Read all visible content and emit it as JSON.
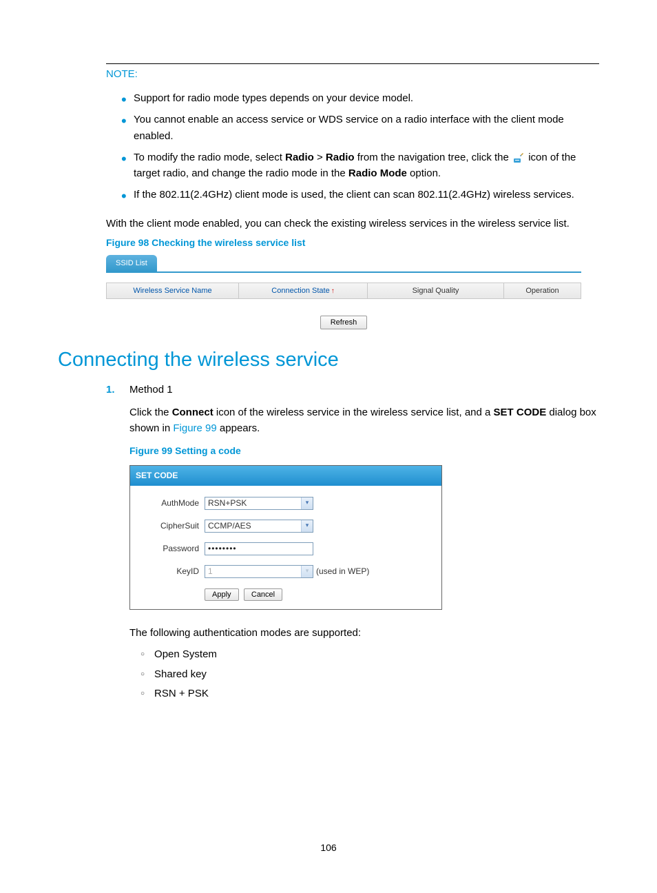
{
  "note": {
    "label": "NOTE:",
    "bullets": {
      "b1": "Support for radio mode types depends on your device model.",
      "b2": "You cannot enable an access service or WDS service on a radio interface with the client mode enabled.",
      "b3_pre": "To modify the radio mode, select ",
      "b3_radio": "Radio",
      "b3_gt": " > ",
      "b3_radio2": "Radio",
      "b3_mid": " from the navigation tree, click the ",
      "b3_post_icon": " icon of the target radio, and change the radio mode in the ",
      "b3_radio_mode": "Radio Mode",
      "b3_end": " option.",
      "b4": "If the 802.11(2.4GHz) client mode is used, the client can scan 802.11(2.4GHz) wireless services."
    }
  },
  "para_after_note": "With the client mode enabled, you can check the existing wireless services in the wireless service list.",
  "figure98": {
    "caption": "Figure 98 Checking the wireless service list",
    "tab": "SSID List",
    "headers": {
      "name": "Wireless Service Name",
      "state": "Connection State",
      "signal": "Signal Quality",
      "operation": "Operation"
    },
    "sort_arrow": "↑",
    "refresh": "Refresh"
  },
  "section_heading": "Connecting the wireless service",
  "steps": {
    "num1": "1.",
    "title1": "Method 1",
    "p1_pre": "Click the ",
    "p1_connect": "Connect",
    "p1_mid": " icon of the wireless service in the wireless service list, and a ",
    "p1_setcode": "SET CODE",
    "p1_mid2": " dialog box shown in ",
    "p1_figref": "Figure 99",
    "p1_end": " appears."
  },
  "figure99": {
    "caption": "Figure 99 Setting a code",
    "title": "SET CODE",
    "labels": {
      "authmode": "AuthMode",
      "ciphersuit": "CipherSuit",
      "password": "Password",
      "keyid": "KeyID"
    },
    "values": {
      "authmode": "RSN+PSK",
      "ciphersuit": "CCMP/AES",
      "password": "••••••••",
      "keyid": "1"
    },
    "keyid_note": "(used in WEP)",
    "apply": "Apply",
    "cancel": "Cancel"
  },
  "auth_intro": "The following authentication modes are supported:",
  "auth_modes": {
    "m1": "Open System",
    "m2": "Shared key",
    "m3": "RSN + PSK"
  },
  "page_number": "106"
}
